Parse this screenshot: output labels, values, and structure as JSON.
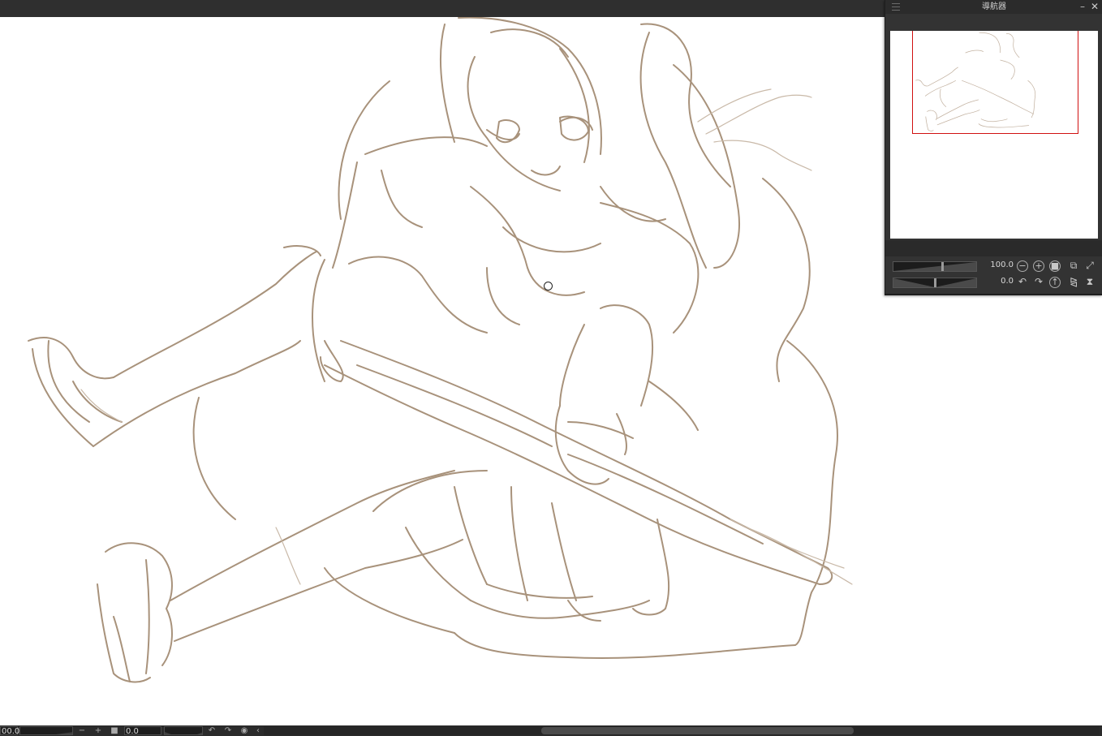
{
  "navigator": {
    "title": "導航器",
    "minimize_icon": "minimize-icon",
    "close_icon": "close-icon",
    "zoom_value": "100.0",
    "rotation_value": "0.0"
  },
  "statusbar": {
    "zoom_value": "00.0",
    "rotation_value": "0.0"
  },
  "colors": {
    "sketch_stroke": "#a8927b",
    "viewport_frame": "#d01010",
    "panel_bg": "#333333",
    "titlebar_bg": "#2f2f2f"
  }
}
